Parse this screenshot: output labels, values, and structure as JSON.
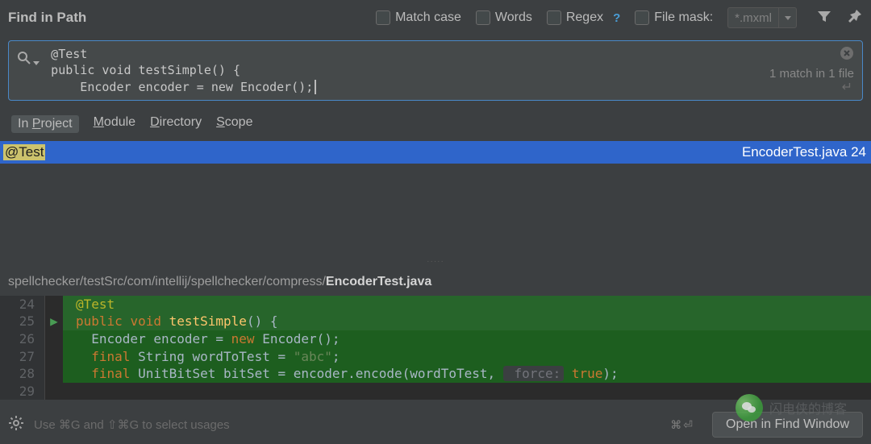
{
  "title": "Find in Path",
  "options": {
    "match_case": "Match case",
    "words": "Words",
    "regex": "Regex",
    "regex_help": "?",
    "file_mask": "File mask:",
    "file_mask_value": "*.mxml"
  },
  "search": {
    "line1": "@Test",
    "line2": "public void testSimple() {",
    "line3": "    Encoder encoder = new Encoder();",
    "match_info": "1 match in 1 file"
  },
  "scope": {
    "in_project": "In Project",
    "module": "Module",
    "directory": "Directory",
    "scope": "Scope"
  },
  "result": {
    "match": "@Test",
    "location": "EncoderTest.java 24"
  },
  "preview": {
    "path_prefix": "spellchecker/testSrc/com/intellij/spellchecker/compress/",
    "path_file": "EncoderTest.java",
    "lines": {
      "24": {
        "no": "24",
        "anno": "@Test"
      },
      "25": {
        "no": "25",
        "kw1": "public",
        "kw2": "void",
        "method": "testSimple",
        "rest": "() {"
      },
      "26": {
        "no": "26",
        "t1": "Encoder encoder = ",
        "kw": "new",
        "t2": " Encoder();"
      },
      "27": {
        "no": "27",
        "kw": "final",
        "t1": " String wordToTest = ",
        "str": "\"abc\"",
        "t2": ";"
      },
      "28": {
        "no": "28",
        "kw": "final",
        "t1": " UnitBitSet bitSet = encoder.encode(wordToTest, ",
        "param": " force:",
        "kw2": " true",
        "t2": ");"
      },
      "29": {
        "no": "29"
      }
    }
  },
  "footer": {
    "hint": "Use ⌘G and ⇧⌘G to select usages",
    "shortcut": "⌘⏎",
    "button": "Open in Find Window"
  },
  "watermark": "闪电侠的博客"
}
